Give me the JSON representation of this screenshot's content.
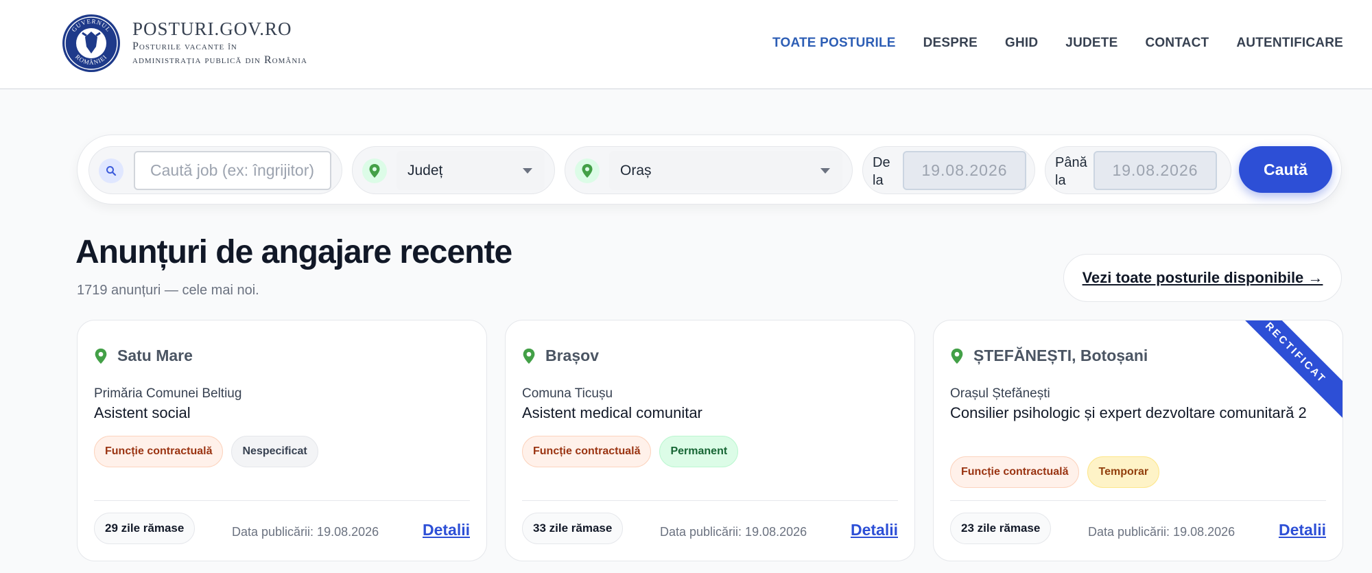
{
  "header": {
    "brand_title": "POSTURI.GOV.RO",
    "brand_subtitle_line1": "Posturile vacante în",
    "brand_subtitle_line2": "administrația publică din România",
    "logo_text_top": "GUVERNUL",
    "logo_text_bottom": "ROMÂNIEI",
    "nav": [
      {
        "label": "TOATE POSTURILE",
        "active": true
      },
      {
        "label": "DESPRE"
      },
      {
        "label": "GHID"
      },
      {
        "label": "JUDETE"
      },
      {
        "label": "CONTACT"
      },
      {
        "label": "AUTENTIFICARE"
      }
    ]
  },
  "search": {
    "job_placeholder": "Caută job (ex: îngrijitor)",
    "county_label": "Județ",
    "city_label": "Oraș",
    "from_label_1": "De",
    "from_label_2": "la",
    "from_date": "19.08.2026",
    "to_label_1": "Până",
    "to_label_2": "la",
    "to_date": "19.08.2026",
    "submit_label": "Caută"
  },
  "section": {
    "title": "Anunțuri de angajare recente",
    "subtitle": "1719 anunțuri — cele mai noi.",
    "see_all_label": "Vezi toate posturile disponibile →"
  },
  "cards": [
    {
      "location": "Satu Mare",
      "employer": "Primăria Comunei Beltiug",
      "title": "Asistent social",
      "tags": [
        "Funcție contractuală",
        "Nespecificat"
      ],
      "days_left": "29 zile rămase",
      "published": "Data publicării: 19.08.2026",
      "details_label": "Detalii"
    },
    {
      "location": "Brașov",
      "employer": "Comuna Ticușu",
      "title": "Asistent medical comunitar",
      "tags": [
        "Funcție contractuală",
        "Permanent"
      ],
      "days_left": "33 zile rămase",
      "published": "Data publicării: 19.08.2026",
      "details_label": "Detalii"
    },
    {
      "location": "ȘTEFĂNEȘTI, Botoșani",
      "employer": "Orașul Ștefănești",
      "title": "Consilier psihologic și expert dezvoltare comunitară 2",
      "tags": [
        "Funcție contractuală",
        "Temporar"
      ],
      "days_left": "23 zile rămase",
      "published": "Data publicării: 19.08.2026",
      "details_label": "Detalii",
      "ribbon": "RECTIFICAT"
    }
  ],
  "colors": {
    "accent": "#2d4fd6",
    "nav_active": "#2d5eb5",
    "pin": "#43a047"
  }
}
